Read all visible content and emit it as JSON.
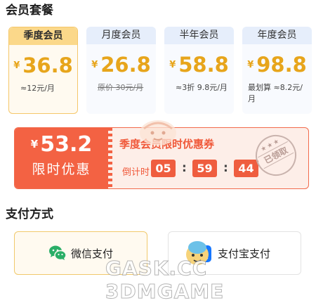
{
  "section1_title": "会员套餐",
  "section2_title": "支付方式",
  "plans": [
    {
      "name": "季度会员",
      "currency": "¥",
      "price": "36.8",
      "note_line1": "≈12元/月",
      "note_line2": "",
      "strike": "",
      "selected": true
    },
    {
      "name": "月度会员",
      "currency": "¥",
      "price": "26.8",
      "note_line1": "原价 30元/月",
      "note_line2": "",
      "strike": "原价 30元/月",
      "selected": false
    },
    {
      "name": "半年会员",
      "currency": "¥",
      "price": "58.8",
      "note_line1": "≈3折 9.8元/月",
      "note_line2": "",
      "strike": "",
      "selected": false
    },
    {
      "name": "年度会员",
      "currency": "¥",
      "price": "98.8",
      "note_line1": "最划算 ≈8.2元/",
      "note_line2": "月",
      "strike": "",
      "selected": false
    }
  ],
  "coupon": {
    "currency": "¥",
    "price": "53.2",
    "label": "限时优惠",
    "title": "季度会员限时优惠券",
    "countdown_label": "倒计时",
    "hours": "05",
    "minutes": "59",
    "seconds": "44",
    "separator": ":",
    "stamp_text": "已领取",
    "stamp_stars": "★★★"
  },
  "payments": [
    {
      "label": "微信支付",
      "icon": "wechat-icon",
      "selected": true
    },
    {
      "label": "支付宝支付",
      "icon": "alipay-icon",
      "selected": false
    }
  ],
  "watermark": "GASK.CC 3DMGAME",
  "colors": {
    "accent_orange": "#f36243",
    "gold": "#e7a51b",
    "selected_border": "#f5c769"
  }
}
